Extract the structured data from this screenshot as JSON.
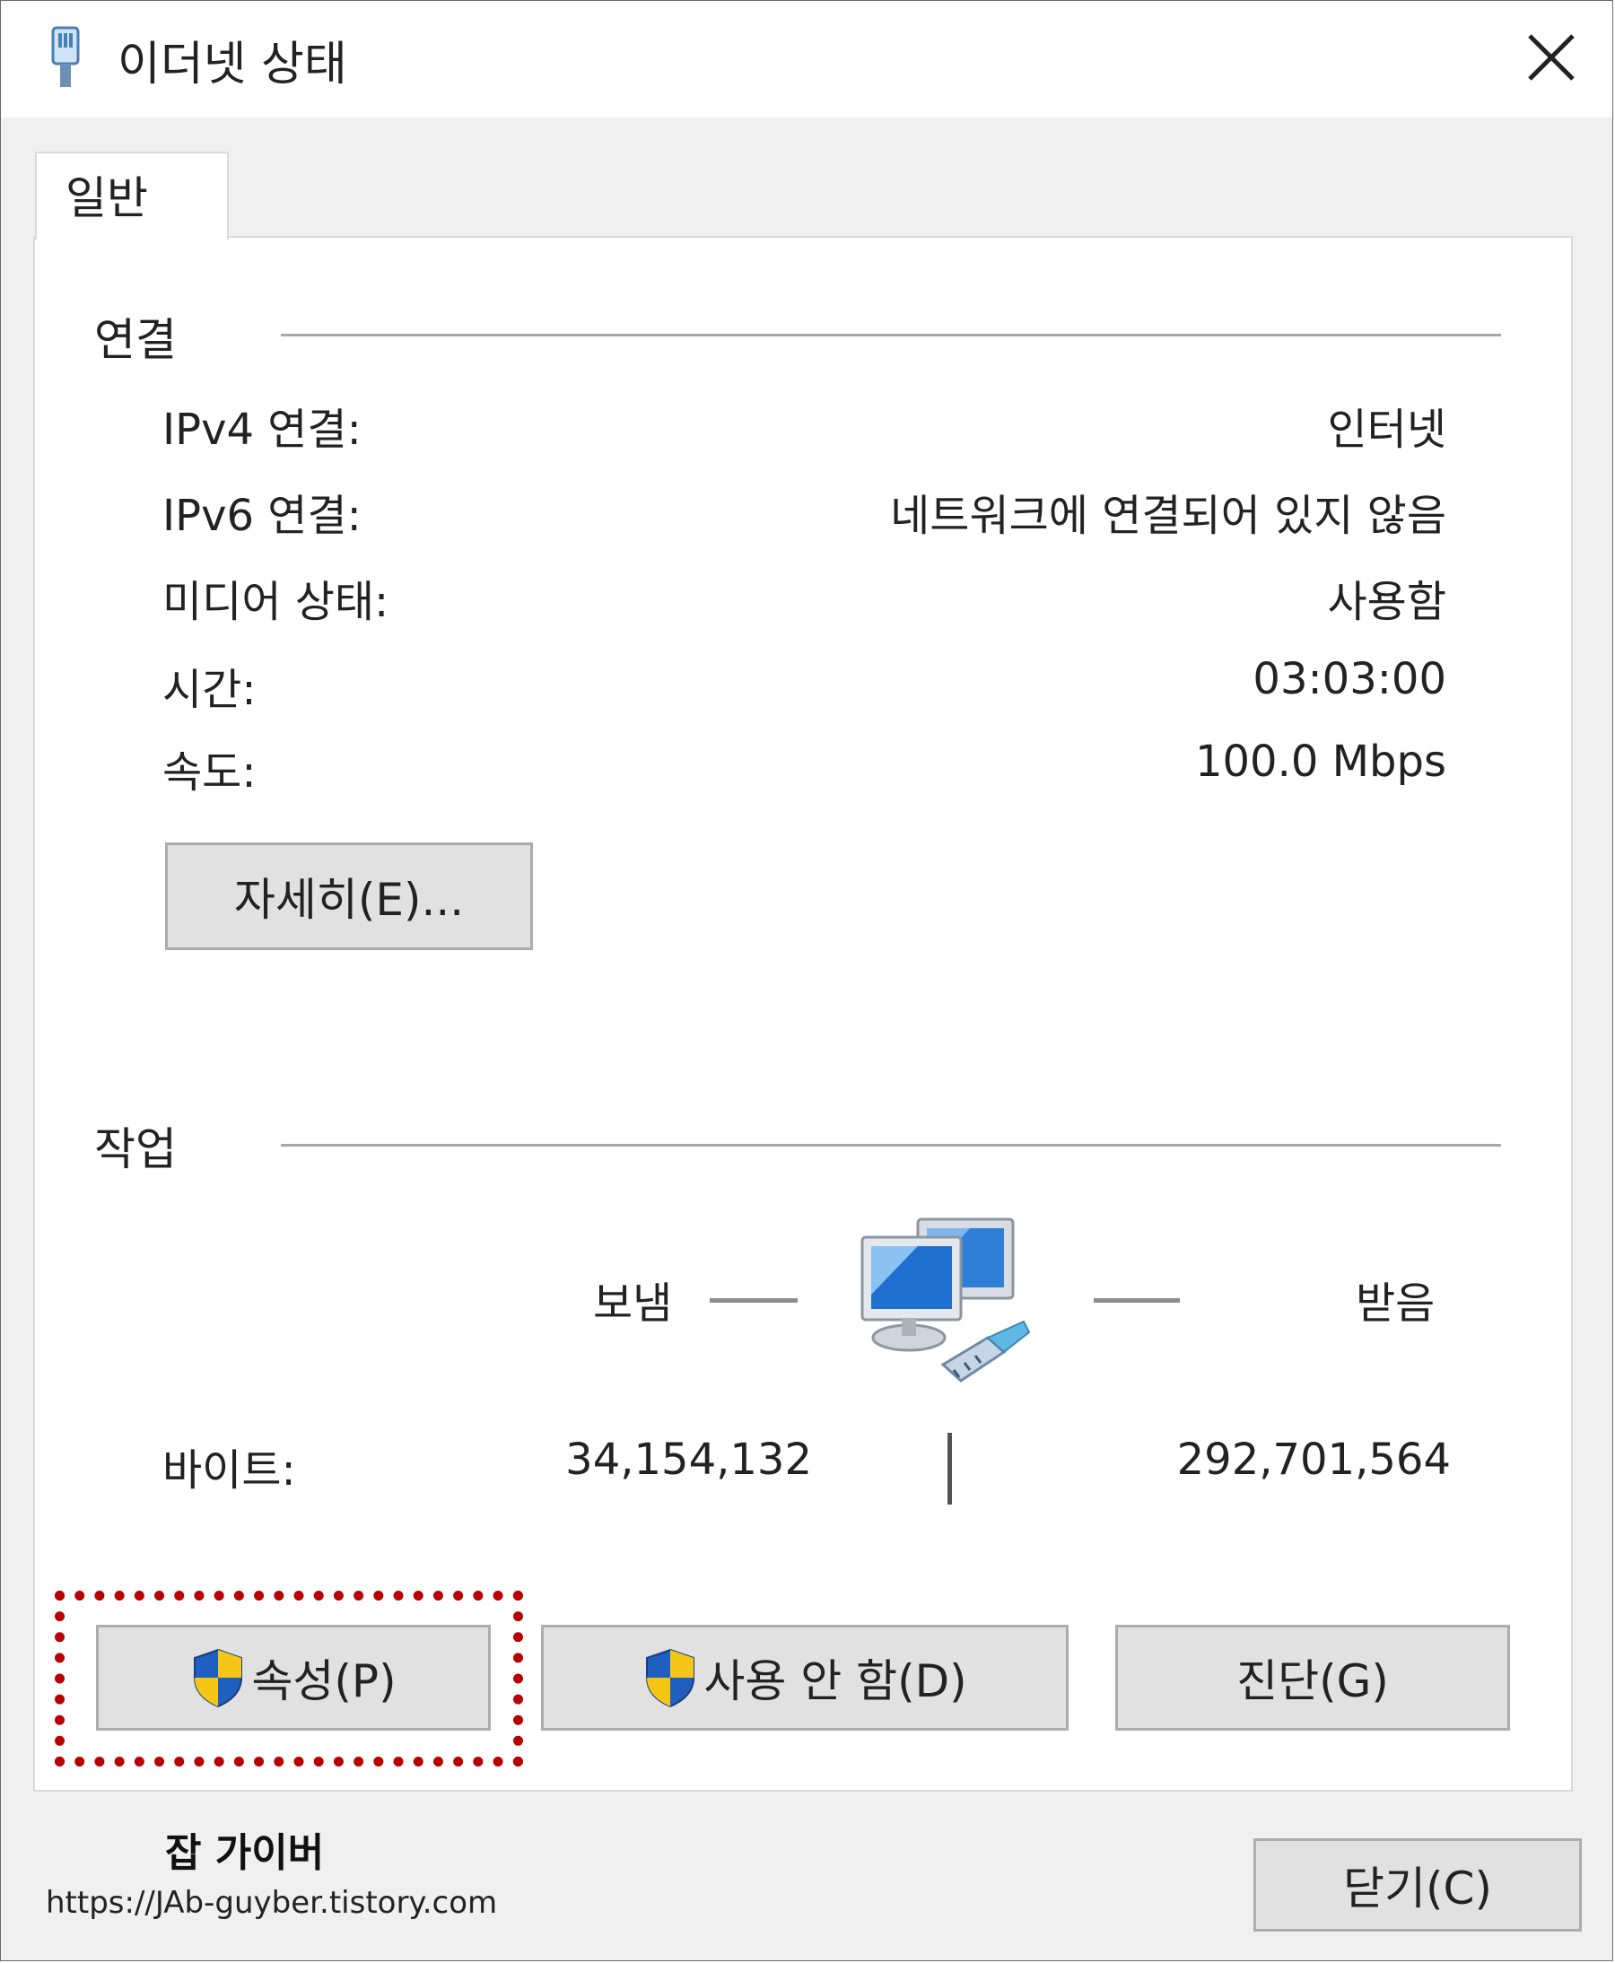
{
  "window": {
    "title": "이더넷 상태"
  },
  "tabs": [
    {
      "label": "일반"
    }
  ],
  "connection": {
    "heading": "연결",
    "rows": [
      {
        "label": "IPv4 연결:",
        "value": "인터넷"
      },
      {
        "label": "IPv6 연결:",
        "value": "네트워크에 연결되어 있지 않음"
      },
      {
        "label": "미디어 상태:",
        "value": "사용함"
      },
      {
        "label": "시간:",
        "value": "03:03:00"
      },
      {
        "label": "속도:",
        "value": "100.0 Mbps"
      }
    ],
    "details_button": "자세히(E)..."
  },
  "activity": {
    "heading": "작업",
    "sent_label": "보냄",
    "received_label": "받음",
    "bytes_label": "바이트:",
    "bytes_sent": "34,154,132",
    "bytes_received": "292,701,564"
  },
  "buttons": {
    "properties": "속성(P)",
    "disable": "사용 안 함(D)",
    "diagnose": "진단(G)",
    "close": "닫기(C)"
  },
  "watermark": {
    "name": "잡 가이버",
    "url": "https://JAb-guyber.tistory.com"
  },
  "colors": {
    "highlight": "#b80000",
    "shield_blue": "#1f5fbf",
    "shield_yellow": "#f5c518",
    "button_face": "#e1e1e1"
  },
  "icons": [
    "ethernet-icon",
    "close-icon",
    "uac-shield-icon",
    "network-computers-icon"
  ]
}
